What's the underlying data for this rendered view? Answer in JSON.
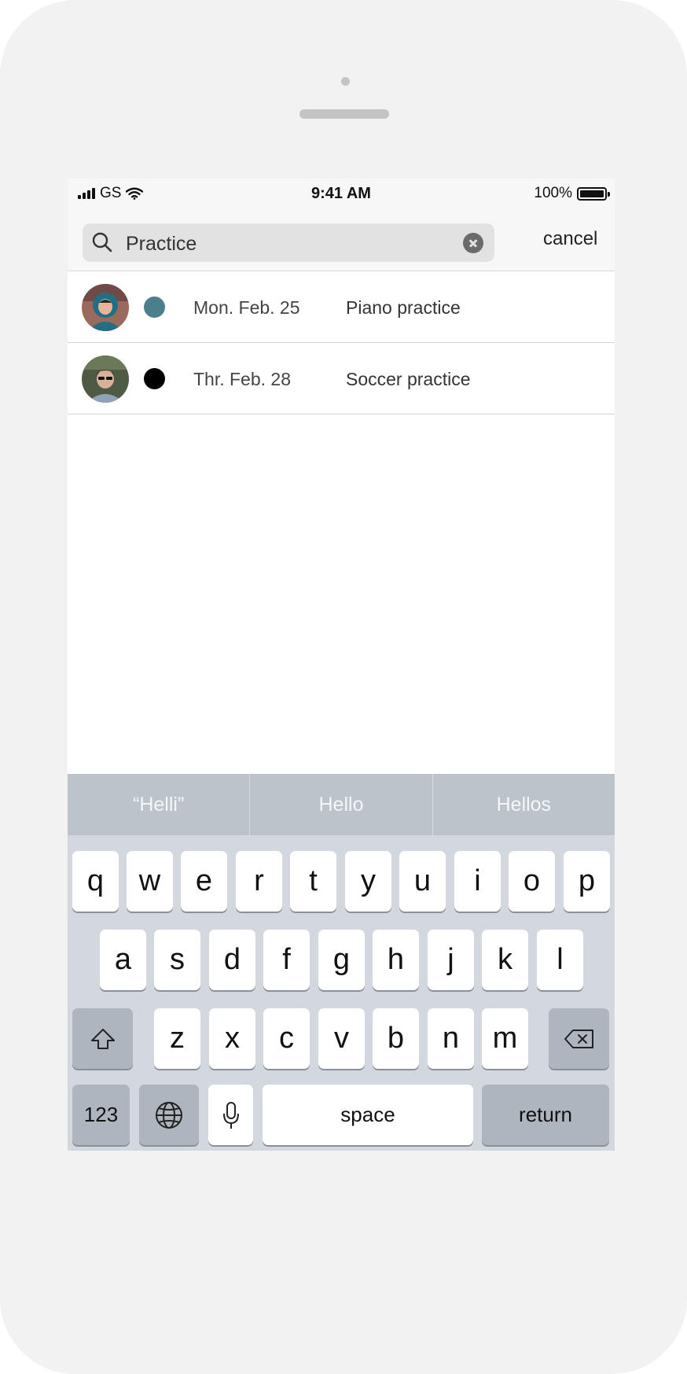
{
  "status_bar": {
    "carrier": "GS",
    "time": "9:41 AM",
    "battery": "100%"
  },
  "search": {
    "query": "Practice",
    "cancel_label": "cancel"
  },
  "results": [
    {
      "date": "Mon. Feb. 25",
      "title": "Piano practice",
      "dot_color": "#4a7f8c"
    },
    {
      "date": "Thr. Feb. 28",
      "title": "Soccer practice",
      "dot_color": "#000000"
    }
  ],
  "keyboard": {
    "suggestions": [
      "“Helli”",
      "Hello",
      "Hellos"
    ],
    "row1": [
      "q",
      "w",
      "e",
      "r",
      "t",
      "y",
      "u",
      "i",
      "o",
      "p"
    ],
    "row2": [
      "a",
      "s",
      "d",
      "f",
      "g",
      "h",
      "j",
      "k",
      "l"
    ],
    "row3": [
      "z",
      "x",
      "c",
      "v",
      "b",
      "n",
      "m"
    ],
    "numbers_label": "123",
    "space_label": "space",
    "return_label": "return"
  },
  "icons": [
    "signal-icon",
    "wifi-icon",
    "battery-icon",
    "search-icon",
    "clear-icon",
    "shift-icon",
    "delete-icon",
    "globe-icon",
    "microphone-icon"
  ]
}
